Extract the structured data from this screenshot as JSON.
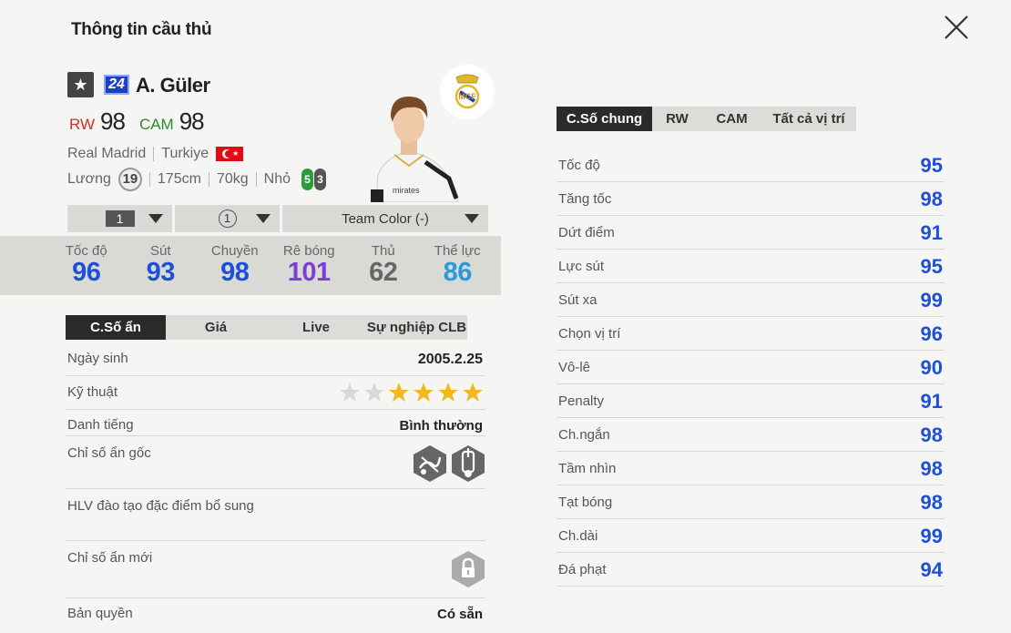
{
  "header": {
    "title": "Thông tin cầu thủ"
  },
  "player": {
    "star_icon": "★",
    "season_number": "24",
    "name": "A. Güler",
    "positions": [
      {
        "pos": "RW",
        "ovr": "98",
        "color": "#d42d2d"
      },
      {
        "pos": "CAM",
        "ovr": "98",
        "color": "#2b8a2b"
      }
    ],
    "club": "Real Madrid",
    "nation": "Turkiye",
    "salary_label": "Lương",
    "salary": "19",
    "height": "175cm",
    "weight": "70kg",
    "body_type": "Nhỏ",
    "weak_foot_left": "5",
    "weak_foot_right": "3"
  },
  "selectors": {
    "level": "1",
    "rank": "1",
    "team_color": "Team Color (-)"
  },
  "main_stats": [
    {
      "label": "Tốc độ",
      "value": "96",
      "color": "#1d4fd8"
    },
    {
      "label": "Sút",
      "value": "93",
      "color": "#1d4fd8"
    },
    {
      "label": "Chuyền",
      "value": "98",
      "color": "#1d4fd8"
    },
    {
      "label": "Rê bóng",
      "value": "101",
      "color": "#7b3fd8"
    },
    {
      "label": "Thủ",
      "value": "62",
      "color": "#666666"
    },
    {
      "label": "Thể lực",
      "value": "86",
      "color": "#2a9ad8"
    }
  ],
  "left_tabs": [
    "C.Số ẩn",
    "Giá",
    "Live",
    "Sự nghiệp CLB"
  ],
  "left_info": {
    "birthday_label": "Ngày sinh",
    "birthday": "2005.2.25",
    "skill_label": "Kỹ thuật",
    "skill_stars": 4,
    "reputation_label": "Danh tiếng",
    "reputation": "Bình thường",
    "hidden_base_label": "Chỉ số ẩn gốc",
    "coach_label": "HLV đào tạo đặc điểm bổ sung",
    "new_hidden_label": "Chỉ số ẩn mới",
    "license_label": "Bản quyền",
    "license": "Có sẵn"
  },
  "right_tabs": [
    "C.Số chung",
    "RW",
    "CAM",
    "Tất cả vị trí"
  ],
  "attributes": [
    {
      "label": "Tốc độ",
      "value": "95"
    },
    {
      "label": "Tăng tốc",
      "value": "98"
    },
    {
      "label": "Dứt điểm",
      "value": "91"
    },
    {
      "label": "Lực sút",
      "value": "95"
    },
    {
      "label": "Sút xa",
      "value": "99"
    },
    {
      "label": "Chọn vị trí",
      "value": "96"
    },
    {
      "label": "Vô-lê",
      "value": "90"
    },
    {
      "label": "Penalty",
      "value": "91"
    },
    {
      "label": "Ch.ngắn",
      "value": "98"
    },
    {
      "label": "Tầm nhìn",
      "value": "98"
    },
    {
      "label": "Tạt bóng",
      "value": "98"
    },
    {
      "label": "Ch.dài",
      "value": "99"
    },
    {
      "label": "Đá phạt",
      "value": "94"
    }
  ],
  "icons": {
    "close": "close-icon",
    "club_logo": "real-madrid-crest-icon",
    "flag": "turkey-flag-icon",
    "trait1": "dribbling-trait-icon",
    "trait2": "shooting-trait-icon",
    "lock": "lock-icon"
  }
}
